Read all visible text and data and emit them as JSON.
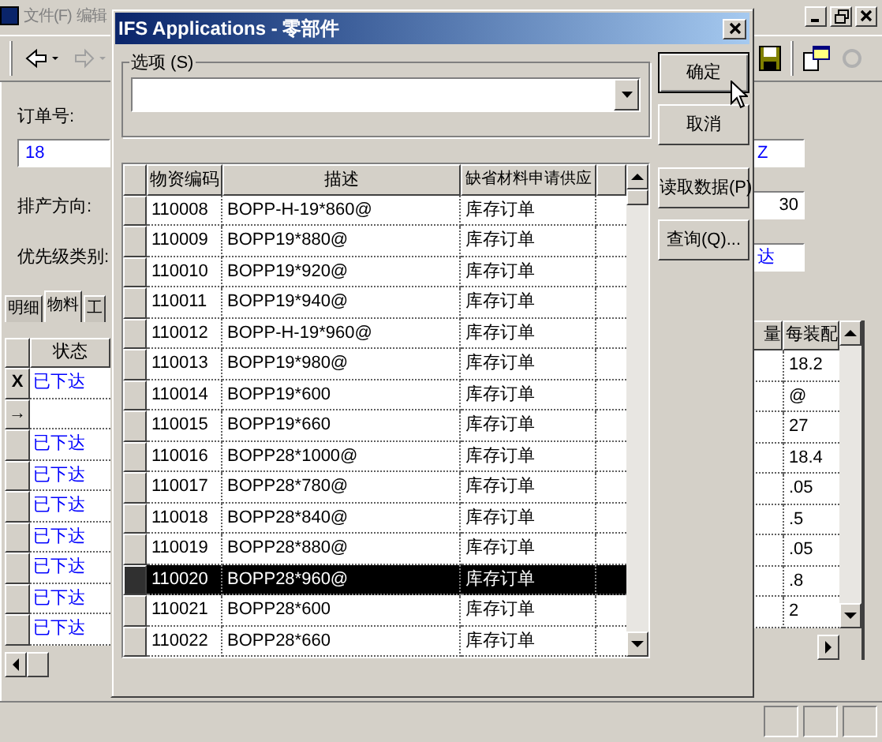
{
  "main_window": {
    "menu": [
      {
        "label": "文件(F)",
        "disabled": true
      },
      {
        "label": "编辑",
        "disabled": true
      }
    ],
    "order_label": "订单号:",
    "order_value": "18",
    "direction_label": "排产方向:",
    "priority_label": "优先级类别:",
    "right_fields": [
      "Z",
      "30",
      "达"
    ],
    "tabs": [
      {
        "label": "明细",
        "selected": false
      },
      {
        "label": "物料",
        "selected": true
      },
      {
        "label": "工",
        "selected": false
      }
    ],
    "left_grid": {
      "header": "状态",
      "rows": [
        {
          "indicator": "X",
          "status": "已下达"
        },
        {
          "indicator": "→",
          "status": ""
        },
        {
          "indicator": "",
          "status": "已下达"
        },
        {
          "indicator": "",
          "status": "已下达"
        },
        {
          "indicator": "",
          "status": "已下达"
        },
        {
          "indicator": "",
          "status": "已下达"
        },
        {
          "indicator": "",
          "status": "已下达"
        },
        {
          "indicator": "",
          "status": "已下达"
        },
        {
          "indicator": "",
          "status": "已下达"
        }
      ]
    },
    "right_grid": {
      "columns": [
        "量",
        "每装配"
      ],
      "values": [
        "18.2",
        "@",
        "27",
        "18.4",
        ".05",
        ".5",
        ".05",
        ".8",
        "2"
      ]
    }
  },
  "dialog": {
    "title": "IFS Applications - 零部件",
    "options_label": "选项 (S)",
    "buttons": [
      "确定",
      "取消",
      "读取数据(P)",
      "查询(Q)..."
    ],
    "grid": {
      "columns": [
        "物资编码",
        "描述",
        "缺省材料申请供应"
      ],
      "rows": [
        {
          "code": "110008",
          "description": "BOPP-H-19*860@",
          "supply": "库存订单",
          "selected": false
        },
        {
          "code": "110009",
          "description": "BOPP19*880@",
          "supply": "库存订单",
          "selected": false
        },
        {
          "code": "110010",
          "description": "BOPP19*920@",
          "supply": "库存订单",
          "selected": false
        },
        {
          "code": "110011",
          "description": "BOPP19*940@",
          "supply": "库存订单",
          "selected": false
        },
        {
          "code": "110012",
          "description": "BOPP-H-19*960@",
          "supply": "库存订单",
          "selected": false
        },
        {
          "code": "110013",
          "description": "BOPP19*980@",
          "supply": "库存订单",
          "selected": false
        },
        {
          "code": "110014",
          "description": "BOPP19*600",
          "supply": "库存订单",
          "selected": false
        },
        {
          "code": "110015",
          "description": "BOPP19*660",
          "supply": "库存订单",
          "selected": false
        },
        {
          "code": "110016",
          "description": "BOPP28*1000@",
          "supply": "库存订单",
          "selected": false
        },
        {
          "code": "110017",
          "description": "BOPP28*780@",
          "supply": "库存订单",
          "selected": false
        },
        {
          "code": "110018",
          "description": "BOPP28*840@",
          "supply": "库存订单",
          "selected": false
        },
        {
          "code": "110019",
          "description": "BOPP28*880@",
          "supply": "库存订单",
          "selected": false
        },
        {
          "code": "110020",
          "description": "BOPP28*960@",
          "supply": "库存订单",
          "selected": true
        },
        {
          "code": "110021",
          "description": "BOPP28*600",
          "supply": "库存订单",
          "selected": false
        },
        {
          "code": "110022",
          "description": "BOPP28*660",
          "supply": "库存订单",
          "selected": false
        }
      ]
    }
  }
}
